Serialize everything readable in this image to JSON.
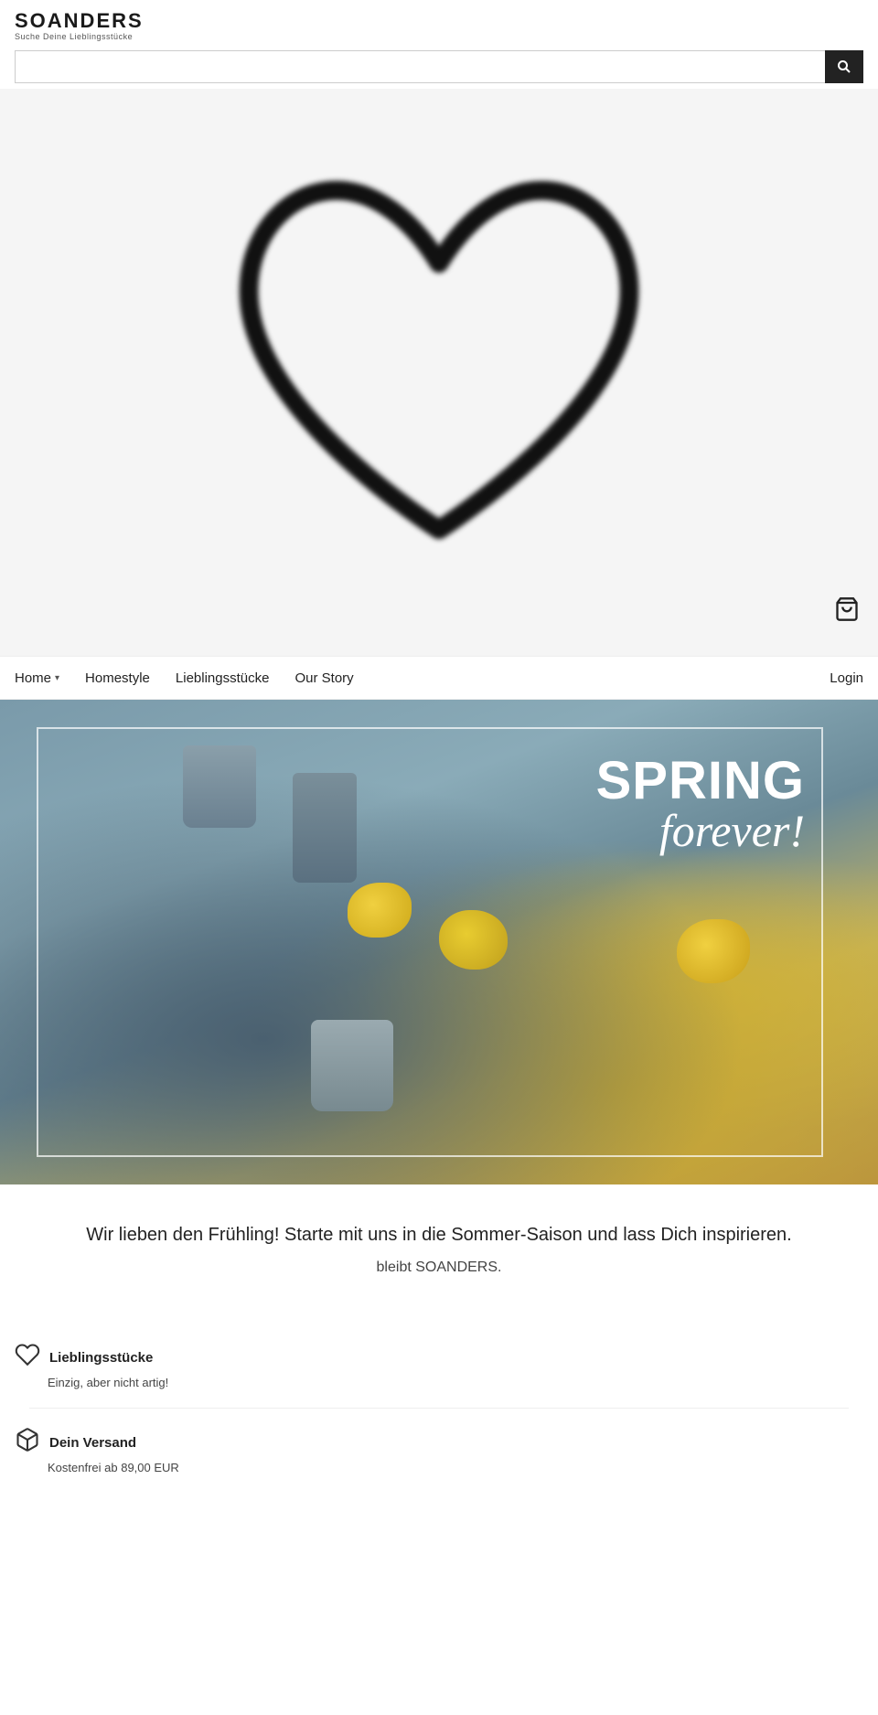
{
  "brand": {
    "name": "SOANDERS",
    "tagline": "Suche Deine Lieblingsstücke"
  },
  "search": {
    "placeholder": "",
    "button_icon": "🔍"
  },
  "cart": {
    "icon": "🛒"
  },
  "nav": {
    "items": [
      {
        "label": "Home",
        "hasChevron": true
      },
      {
        "label": "Homestyle",
        "hasChevron": false
      },
      {
        "label": "Lieblingsstücke",
        "hasChevron": false
      },
      {
        "label": "Our Story",
        "hasChevron": false
      }
    ],
    "login_label": "Login"
  },
  "hero_banner": {
    "spring_line1": "SPRING",
    "spring_line2": "forever!",
    "alt": "Spring forever - tableware scene with cups and lemons"
  },
  "tagline": {
    "main": "Wir lieben den Frühling! Starte mit uns in die Sommer-Saison und lass Dich inspirieren.",
    "sub": "bleibt SOANDERS."
  },
  "features": [
    {
      "icon": "♡",
      "title": "Lieblingsstücke",
      "description": "Einzig, aber nicht artig!"
    },
    {
      "icon": "📦",
      "title": "Dein Versand",
      "description": "Kostenfrei ab 89,00 EUR"
    }
  ]
}
